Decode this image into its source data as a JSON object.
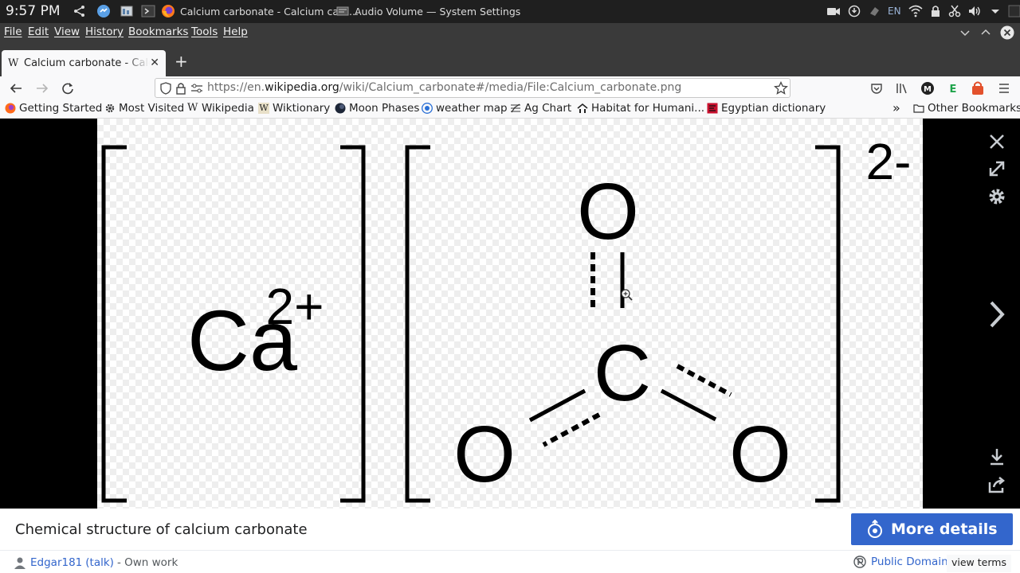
{
  "taskbar": {
    "clock": "9:57 PM",
    "tasks": [
      {
        "label": "Calcium carbonate - Calcium carb..."
      },
      {
        "label": "Audio Volume — System Settings"
      }
    ],
    "keyboard_layout": "EN"
  },
  "menubar": {
    "items": [
      "File",
      "Edit",
      "View",
      "History",
      "Bookmarks",
      "Tools",
      "Help"
    ]
  },
  "tab": {
    "favicon": "W",
    "title": "Calcium carbonate - Calcium carbonate",
    "close": "✕",
    "new_tab": "+"
  },
  "navbar": {
    "url_prefix": "https://en.",
    "url_domain": "wikipedia.org",
    "url_path": "/wiki/Calcium_carbonate#/media/File:Calcium_carbonate.png"
  },
  "bookmarks": {
    "items": [
      {
        "label": "Getting Started",
        "icon": "firefox-icon"
      },
      {
        "label": "Most Visited",
        "icon": "gear-icon"
      },
      {
        "label": "Wikipedia",
        "icon": "wikipedia-icon"
      },
      {
        "label": "Wiktionary",
        "icon": "wiktionary-icon"
      },
      {
        "label": "Moon Phases",
        "icon": "moon-icon"
      },
      {
        "label": "weather map",
        "icon": "radar-icon"
      },
      {
        "label": "Ag Chart",
        "icon": "chart-icon"
      },
      {
        "label": "Habitat for Humani...",
        "icon": "habitat-icon"
      },
      {
        "label": "Egyptian dictionary",
        "icon": "dictionary-icon"
      }
    ],
    "overflow": "»",
    "other_label": "Other Bookmarks"
  },
  "structure": {
    "cation_symbol": "Ca",
    "cation_charge": "2+",
    "anion_charge": "2-",
    "atom_o_top": "O",
    "atom_c": "C",
    "atom_o_left": "O",
    "atom_o_right": "O"
  },
  "caption": {
    "text": "Chemical structure of calcium carbonate",
    "more_details": "More details"
  },
  "attribution": {
    "author": "Edgar181",
    "talk": "(talk)",
    "source": "- Own work",
    "license": "Public Domain",
    "terms": "view terms"
  },
  "colors": {
    "accent": "#3366cc",
    "toolbar_bg": "#f9f9fa",
    "chrome_dark": "#3a3a3a",
    "viewer_bg": "#000000"
  }
}
